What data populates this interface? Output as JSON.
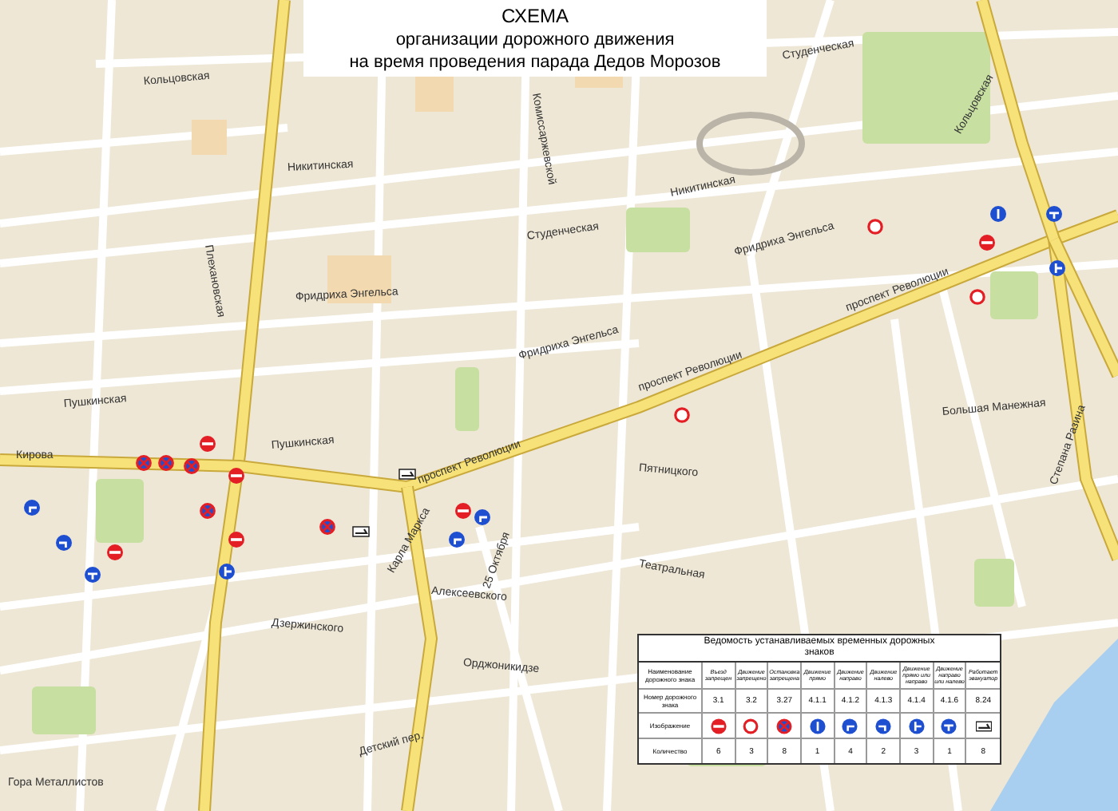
{
  "title": [
    "СХЕМА",
    "организации дорожного движения",
    "на время проведения парада Дедов Морозов"
  ],
  "map": {
    "street_labels": [
      {
        "text": "Кольцовская"
      },
      {
        "text": "Студенческая"
      },
      {
        "text": "Никитинская"
      },
      {
        "text": "Никитинская"
      },
      {
        "text": "Фридриха Энгельса"
      },
      {
        "text": "Фридриха Энгельса"
      },
      {
        "text": "Фридриха Энгельса"
      },
      {
        "text": "Пушкинская"
      },
      {
        "text": "Пушкинская"
      },
      {
        "text": "Кирова"
      },
      {
        "text": "проспект Революции"
      },
      {
        "text": "проспект Революции"
      },
      {
        "text": "проспект Революции"
      },
      {
        "text": "Плехановская"
      },
      {
        "text": "Дзержинского"
      },
      {
        "text": "Алексеевского"
      },
      {
        "text": "Театральная"
      },
      {
        "text": "Орджоникидзе"
      },
      {
        "text": "Большая Манежная"
      },
      {
        "text": "Степана Разина"
      },
      {
        "text": "Карла Маркса"
      },
      {
        "text": "Студенческая"
      },
      {
        "text": "Комиссаржевской"
      },
      {
        "text": "Пятницкого"
      },
      {
        "text": "Детский пер."
      },
      {
        "text": "Гора Металлистов"
      },
      {
        "text": "25 Октября"
      },
      {
        "text": "Кольцовская"
      }
    ]
  },
  "table": {
    "title": "Ведомость устанавливаемых временных дорожных знаков",
    "rows": [
      {
        "kind": "text",
        "header": "Наименование дорожного знака",
        "cells": [
          "Въезд запрещен",
          "Движение запрещено",
          "Остановка запрещена",
          "Движение прямо",
          "Движение направо",
          "Движение налево",
          "Движение прямо или направо",
          "Движение направо или налево",
          "Работает эвакуатор"
        ]
      },
      {
        "kind": "text",
        "header": "Номер дорожного знака",
        "cells": [
          "3.1",
          "3.2",
          "3.27",
          "4.1.1",
          "4.1.2",
          "4.1.3",
          "4.1.4",
          "4.1.6",
          "8.24"
        ]
      },
      {
        "kind": "signs",
        "header": "Изображение",
        "cells": [
          {
            "kind": "no_entry"
          },
          {
            "kind": "no_traffic"
          },
          {
            "kind": "no_stopping"
          },
          {
            "kind": "straight"
          },
          {
            "kind": "right"
          },
          {
            "kind": "left"
          },
          {
            "kind": "straight_right"
          },
          {
            "kind": "right_left"
          },
          {
            "kind": "tow_truck"
          }
        ]
      },
      {
        "kind": "text",
        "header": "Количество",
        "cells": [
          "6",
          "3",
          "8",
          "1",
          "4",
          "2",
          "3",
          "1",
          "8"
        ]
      }
    ]
  }
}
